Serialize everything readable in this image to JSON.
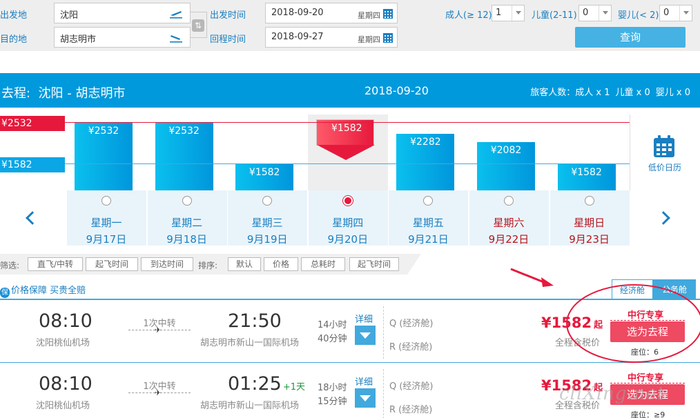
{
  "search": {
    "from_label": "出发地",
    "to_label": "目的地",
    "from_value": "沈阳",
    "to_value": "胡志明市",
    "depart_label": "出发时间",
    "return_label": "回程时间",
    "depart_date": "2018-09-20",
    "depart_week": "星期四",
    "return_date": "2018-09-27",
    "return_week": "星期四",
    "adult_label": "成人(≥ 12)",
    "adult_value": "1",
    "child_label": "儿童(2-11)",
    "child_value": "0",
    "infant_label": "婴儿(< 2)",
    "infant_value": "0",
    "query_label": "查询"
  },
  "banner": {
    "direction": "去程:",
    "route": "沈阳 - 胡志明市",
    "date": "2018-09-20",
    "pax_label": "旅客人数：",
    "adult": "成人 x 1",
    "child": "儿童 x 0",
    "infant": "婴儿 x 0"
  },
  "chart_data": {
    "type": "bar",
    "categories": [
      "9月17日",
      "9月18日",
      "9月19日",
      "9月20日",
      "9月21日",
      "9月22日",
      "9月23日"
    ],
    "weekdays": [
      "星期一",
      "星期二",
      "星期三",
      "星期四",
      "星期五",
      "星期六",
      "星期日"
    ],
    "values": [
      2532,
      2532,
      1582,
      1582,
      2282,
      2082,
      1582
    ],
    "labels": [
      "¥2532",
      "¥2532",
      "¥1582",
      "¥1582",
      "¥2282",
      "¥2082",
      "¥1582"
    ],
    "selected_index": 3,
    "weekend_indices": [
      5,
      6
    ],
    "max_label": "¥2532",
    "min_label": "¥1582",
    "max_value": 2532,
    "min_value": 1582,
    "colors": {
      "bar": "#0aa6e6",
      "selected": "#e6193c",
      "max_line": "#e6193c",
      "min_line": "#41a9dd"
    }
  },
  "low_price_calendar": "低价日历",
  "filters": {
    "filter_label": "筛选:",
    "filter_buttons": [
      "直飞/中转",
      "起飞时间",
      "到达时间"
    ],
    "sort_label": "排序:",
    "sort_buttons": [
      "默认",
      "价格",
      "总耗时",
      "起飞时间"
    ]
  },
  "guarantee": {
    "icon": "保",
    "text": "价格保障 买贵全赔"
  },
  "tabs": {
    "economy": "经济舱",
    "business": "公务舱"
  },
  "flights": [
    {
      "dep_time": "08:10",
      "dep_airport": "沈阳桃仙机场",
      "stops": "1次中转",
      "arr_time": "21:50",
      "plus_day": "",
      "arr_airport": "胡志明市新山一国际机场",
      "duration_h": "14小时",
      "duration_m": "40分钟",
      "detail": "详细",
      "cabin_1": "Q (经济舱)",
      "cabin_2": "R (经济舱)",
      "price": "¥1582",
      "price_suffix": "起",
      "tax_note": "全程含税价",
      "bank": "中行专享",
      "choose": "选为去程",
      "seats": "座位：6"
    },
    {
      "dep_time": "08:10",
      "dep_airport": "沈阳桃仙机场",
      "stops": "1次中转",
      "arr_time": "01:25",
      "plus_day": "+1天",
      "arr_airport": "胡志明市新山一国际机场",
      "duration_h": "18小时",
      "duration_m": "15分钟",
      "detail": "详细",
      "cabin_1": "Q (经济舱)",
      "cabin_2": "R (经济舱)",
      "price": "¥1582",
      "price_suffix": "起",
      "tax_note": "全程含税价",
      "bank": "中行专享",
      "choose": "选为去程",
      "seats": "座位：≥9"
    }
  ],
  "watermark": "cliXing.net"
}
